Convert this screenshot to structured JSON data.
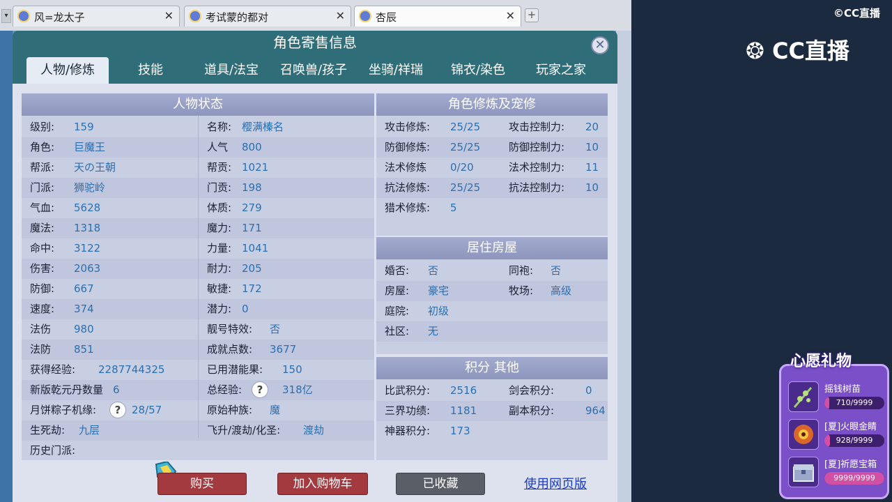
{
  "browser_tabs": [
    {
      "title": "风=龙太子"
    },
    {
      "title": "考试蒙的都对"
    },
    {
      "title": "杏辰",
      "active": true
    }
  ],
  "dialog": {
    "title": "角色寄售信息",
    "close_icon": "close-icon",
    "tabs": [
      "人物/修炼",
      "技能",
      "道具/法宝",
      "召唤兽/孩子",
      "坐骑/祥瑞",
      "锦衣/染色",
      "玩家之家"
    ],
    "active_tab": 0
  },
  "status_panel": {
    "title": "人物状态",
    "left": [
      {
        "label": "级别:",
        "value": "159"
      },
      {
        "label": "角色:",
        "value": "巨魔王"
      },
      {
        "label": "帮派:",
        "value": "天の王朝"
      },
      {
        "label": "门派:",
        "value": "狮驼岭"
      },
      {
        "label": "气血:",
        "value": "5628"
      },
      {
        "label": "魔法:",
        "value": "1318"
      },
      {
        "label": "命中:",
        "value": "3122"
      },
      {
        "label": "伤害:",
        "value": "2063"
      },
      {
        "label": "防御:",
        "value": "667"
      },
      {
        "label": "速度:",
        "value": "374"
      },
      {
        "label": "法伤",
        "value": "980"
      },
      {
        "label": "法防",
        "value": "851"
      },
      {
        "label": "获得经验:",
        "value": "2287744325"
      },
      {
        "label": "新版乾元丹数量",
        "value": "6"
      },
      {
        "label": "月饼粽子机缘:",
        "value": "28/57"
      },
      {
        "label": "生死劫:",
        "value": "九层"
      },
      {
        "label": "历史门派:",
        "value": ""
      }
    ],
    "right": [
      {
        "label": "名称:",
        "value": "樱满榛名"
      },
      {
        "label": "人气",
        "value": "800"
      },
      {
        "label": "帮贡:",
        "value": "1021"
      },
      {
        "label": "门贡:",
        "value": "198"
      },
      {
        "label": "体质:",
        "value": "279"
      },
      {
        "label": "魔力:",
        "value": "171"
      },
      {
        "label": "力量:",
        "value": "1041"
      },
      {
        "label": "耐力:",
        "value": "205"
      },
      {
        "label": "敏捷:",
        "value": "172"
      },
      {
        "label": "潜力:",
        "value": "0"
      },
      {
        "label": "靓号特效:",
        "value": "否"
      },
      {
        "label": "成就点数:",
        "value": "3677"
      },
      {
        "label": "已用潜能果:",
        "value": "150"
      },
      {
        "label": "总经验:",
        "value": "318亿"
      },
      {
        "label": "原始种族:",
        "value": "魔"
      },
      {
        "label": "飞升/渡劫/化圣:",
        "value": "渡劫"
      }
    ]
  },
  "cultivation_panel": {
    "title": "角色修炼及宠修",
    "rows": [
      {
        "l1": "攻击修炼:",
        "v1": "25/25",
        "l2": "攻击控制力:",
        "v2": "20"
      },
      {
        "l1": "防御修炼:",
        "v1": "25/25",
        "l2": "防御控制力:",
        "v2": "10"
      },
      {
        "l1": "法术修炼",
        "v1": "0/20",
        "l2": "法术控制力:",
        "v2": "11"
      },
      {
        "l1": "抗法修炼:",
        "v1": "25/25",
        "l2": "抗法控制力:",
        "v2": "10"
      },
      {
        "l1": "猎术修炼:",
        "v1": "5",
        "l2": "",
        "v2": ""
      }
    ]
  },
  "house_panel": {
    "title": "居住房屋",
    "rows": [
      {
        "l1": "婚否:",
        "v1": "否",
        "l2": "同袍:",
        "v2": "否"
      },
      {
        "l1": "房屋:",
        "v1": "豪宅",
        "l2": "牧场:",
        "v2": "高级"
      },
      {
        "l1": "庭院:",
        "v1": "初级",
        "l2": "",
        "v2": ""
      },
      {
        "l1": "社区:",
        "v1": "无",
        "l2": "",
        "v2": ""
      }
    ]
  },
  "points_panel": {
    "title": "积分 其他",
    "rows": [
      {
        "l1": "比武积分:",
        "v1": "2516",
        "l2": "剑会积分:",
        "v2": "0"
      },
      {
        "l1": "三界功绩:",
        "v1": "1181",
        "l2": "副本积分:",
        "v2": "964"
      },
      {
        "l1": "神器积分:",
        "v1": "173",
        "l2": "",
        "v2": ""
      }
    ]
  },
  "actions": {
    "buy": "购买",
    "add_cart": "加入购物车",
    "favorited": "已收藏",
    "web_version": "使用网页版"
  },
  "stream": {
    "logo_small": "CC直播",
    "logo_big": "CC直播",
    "wish_title": "心愿礼物",
    "gifts": [
      {
        "name": "摇钱树苗",
        "current": 710,
        "target": 9999,
        "label": "710/9999"
      },
      {
        "name": "[夏]火眼金睛",
        "current": 928,
        "target": 9999,
        "label": "928/9999"
      },
      {
        "name": "[夏]祈愿宝箱",
        "current": 9999,
        "target": 9999,
        "label": "9999/9999"
      }
    ]
  },
  "colors": {
    "dialog_bg": "#2f6d78",
    "panel_head": "#9aa1c6",
    "value_text": "#2a6fb0",
    "buy_button": "#a33a3f",
    "wish_panel": "#7a4fc8"
  }
}
